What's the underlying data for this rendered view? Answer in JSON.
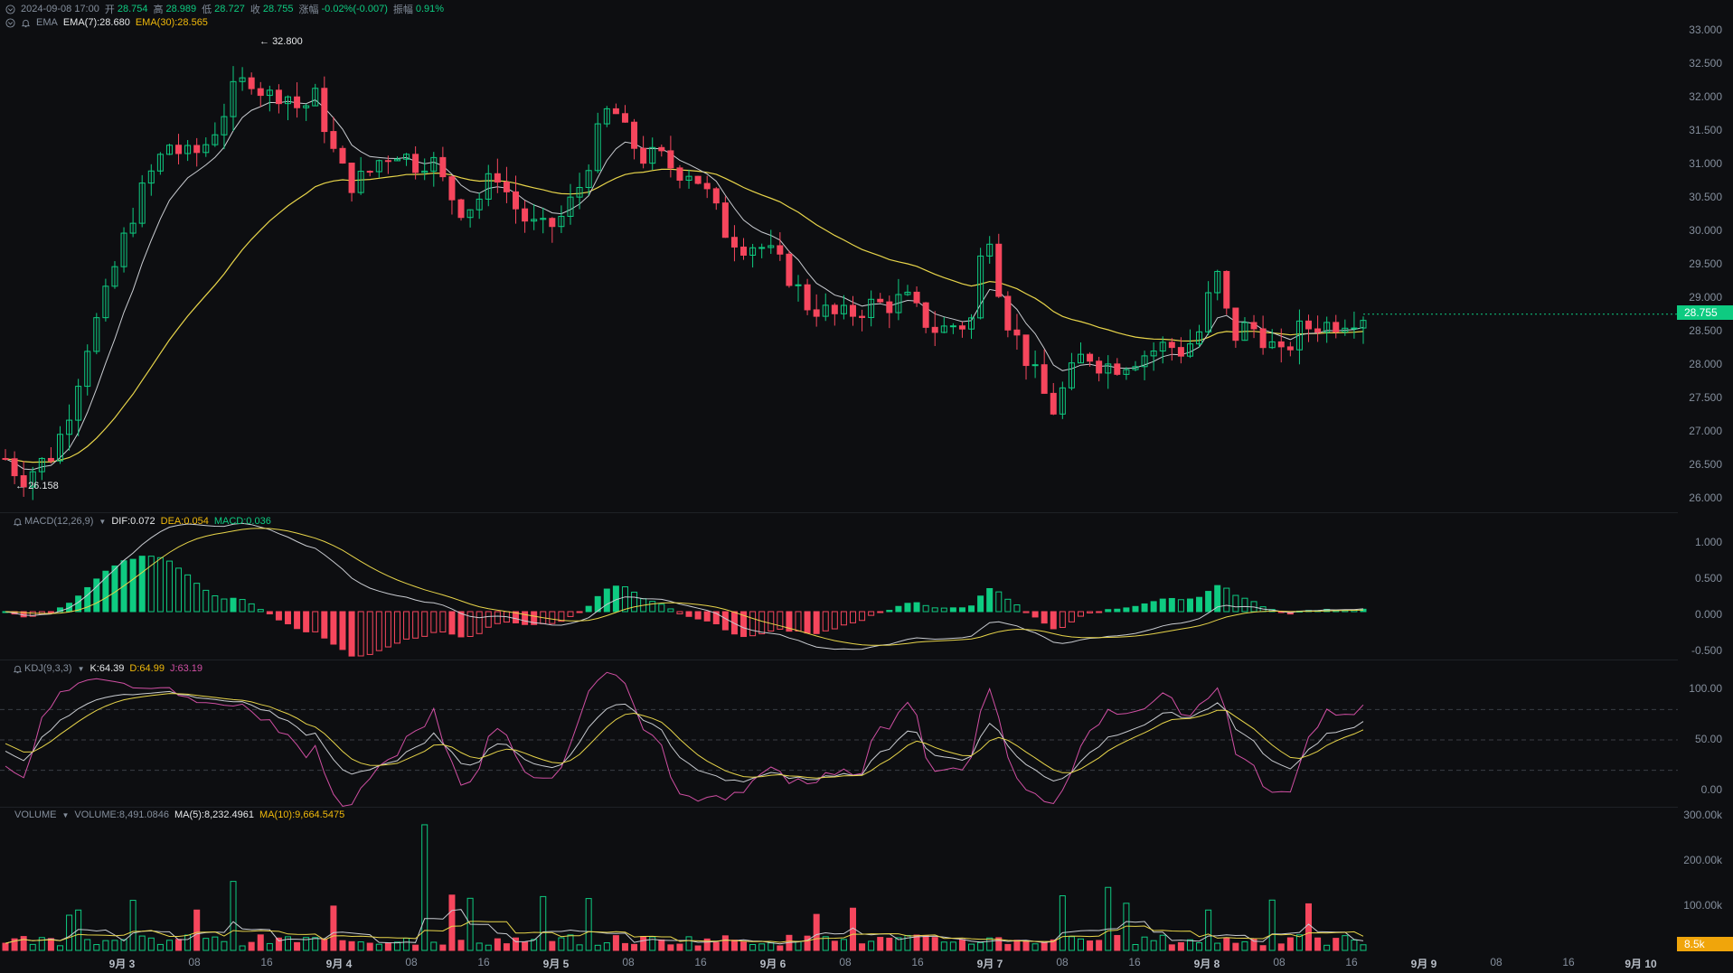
{
  "ohlc": {
    "datetime": "2024-09-08 17:00",
    "open_label": "开",
    "open": "28.754",
    "high_label": "高",
    "high": "28.989",
    "low_label": "低",
    "low": "28.727",
    "close_label": "收",
    "close": "28.755",
    "change_label": "涨幅",
    "change": "-0.02%(-0.007)",
    "amplitude_label": "振幅",
    "amplitude": "0.91%"
  },
  "ema": {
    "name": "EMA",
    "ema7": "EMA(7):28.680",
    "ema30": "EMA(30):28.565"
  },
  "macd": {
    "name": "MACD(12,26,9)",
    "dif": "DIF:0.072",
    "dea": "DEA:0.054",
    "macd": "MACD:0.036"
  },
  "kdj": {
    "name": "KDJ(9,3,3)",
    "k": "K:64.39",
    "d": "D:64.99",
    "j": "J:63.19"
  },
  "volume": {
    "name": "VOLUME",
    "volume": "VOLUME:8,491.0846",
    "ma5": "MA(5):8,232.4961",
    "ma10": "MA(10):9,664.5475"
  },
  "price_axis": [
    "33.000",
    "32.500",
    "32.000",
    "31.500",
    "31.000",
    "30.500",
    "30.000",
    "29.500",
    "29.000",
    "28.500",
    "28.000",
    "27.500",
    "27.000",
    "26.500",
    "26.000"
  ],
  "macd_axis": [
    "1.000",
    "0.500",
    "0.000",
    "-0.500"
  ],
  "kdj_axis": [
    "100.00",
    "50.00",
    "0.00"
  ],
  "volume_axis": [
    "300.00k",
    "200.00k",
    "100.00k"
  ],
  "last_price": "28.755",
  "last_volume": "8.5k",
  "max_label": "32.800",
  "min_label": "26.158",
  "time_axis": [
    {
      "label": "9月 3",
      "bold": true
    },
    {
      "label": "08",
      "bold": false
    },
    {
      "label": "16",
      "bold": false
    },
    {
      "label": "9月 4",
      "bold": true
    },
    {
      "label": "08",
      "bold": false
    },
    {
      "label": "16",
      "bold": false
    },
    {
      "label": "9月 5",
      "bold": true
    },
    {
      "label": "08",
      "bold": false
    },
    {
      "label": "16",
      "bold": false
    },
    {
      "label": "9月 6",
      "bold": true
    },
    {
      "label": "08",
      "bold": false
    },
    {
      "label": "16",
      "bold": false
    },
    {
      "label": "9月 7",
      "bold": true
    },
    {
      "label": "08",
      "bold": false
    },
    {
      "label": "16",
      "bold": false
    },
    {
      "label": "9月 8",
      "bold": true
    },
    {
      "label": "08",
      "bold": false
    },
    {
      "label": "16",
      "bold": false
    },
    {
      "label": "9月 9",
      "bold": true
    },
    {
      "label": "08",
      "bold": false
    },
    {
      "label": "16",
      "bold": false
    },
    {
      "label": "9月 10",
      "bold": true
    }
  ],
  "colors": {
    "up": "#0ecb81",
    "down": "#f6465d",
    "ema7": "#c9ccd1",
    "ema30": "#e8d54a",
    "kdj_k": "#c9ccd1",
    "kdj_d": "#e8d54a",
    "kdj_j": "#d04fa3",
    "background": "#0d0e11"
  },
  "chart_data": {
    "type": "candlestick",
    "interval": "1h",
    "price_range": [
      26.0,
      33.0
    ],
    "candle_closes_approx": [
      26.6,
      26.3,
      26.5,
      26.7,
      27.4,
      28.3,
      28.9,
      29.7,
      30.4,
      30.9,
      31.3,
      31.1,
      31.2,
      31.6,
      32.1,
      32.3,
      32.0,
      32.1,
      31.8,
      32.0,
      31.2,
      30.7,
      30.8,
      31.1,
      31.2,
      31.0,
      31.1,
      30.6,
      30.3,
      30.5,
      30.9,
      30.4,
      30.1,
      30.0,
      30.2,
      30.6,
      31.3,
      31.9,
      31.4,
      31.1,
      31.1,
      30.9,
      30.9,
      30.5,
      30.0,
      29.8,
      29.8,
      29.6,
      29.3,
      28.9,
      28.8,
      28.7,
      28.8,
      28.9,
      28.9,
      29.0,
      28.7,
      28.5,
      28.6,
      28.6,
      30.2,
      28.8,
      28.3,
      27.8,
      27.3,
      27.8,
      28.2,
      28.0,
      28.0,
      28.1,
      28.2,
      28.3,
      28.2,
      28.5,
      29.4,
      28.4,
      28.6,
      28.4,
      28.1,
      28.5,
      28.6,
      28.6,
      28.7,
      28.75
    ]
  }
}
